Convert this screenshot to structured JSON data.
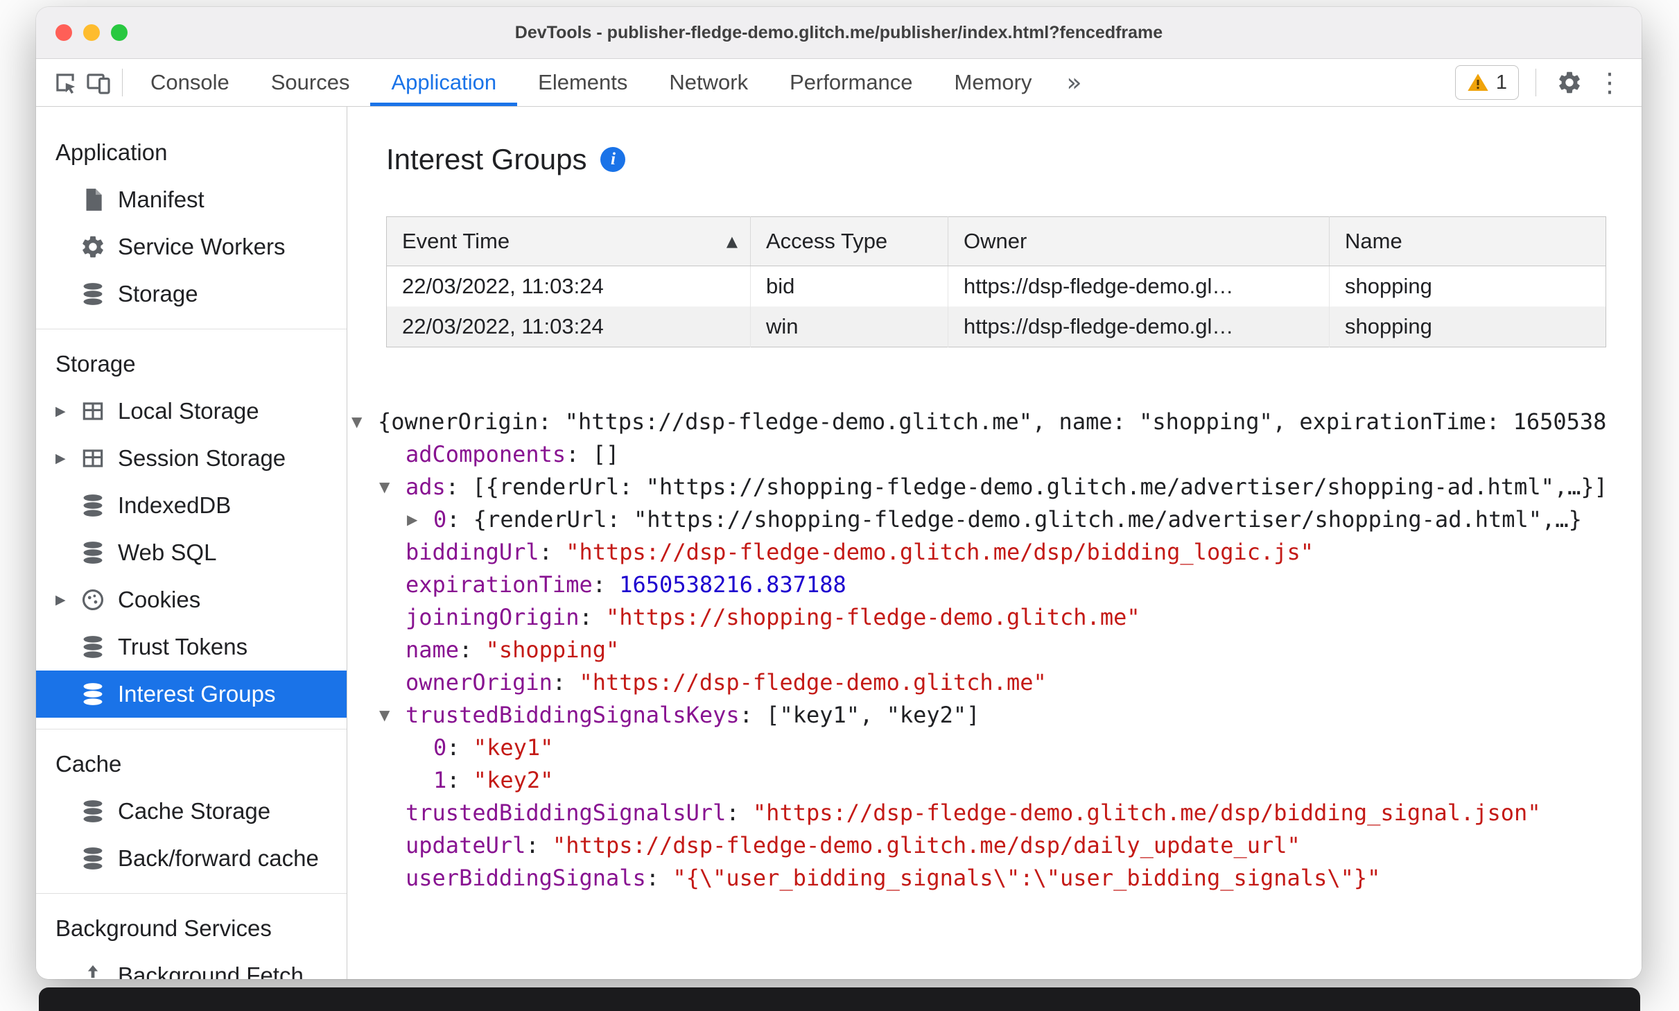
{
  "window": {
    "title": "DevTools - publisher-fledge-demo.glitch.me/publisher/index.html?fencedframe"
  },
  "toolbar": {
    "warning_count": "1",
    "tabs": [
      {
        "label": "Console",
        "active": false
      },
      {
        "label": "Sources",
        "active": false
      },
      {
        "label": "Application",
        "active": true
      },
      {
        "label": "Elements",
        "active": false
      },
      {
        "label": "Network",
        "active": false
      },
      {
        "label": "Performance",
        "active": false
      },
      {
        "label": "Memory",
        "active": false
      }
    ]
  },
  "icons": {
    "more_tabs": "»",
    "dots": "⋮",
    "info": "i",
    "sort_asc": "▲",
    "collapse": "▼",
    "expand": "▶",
    "twisty": "▶"
  },
  "sidebar": {
    "sections": [
      {
        "title": "Application",
        "items": [
          {
            "label": "Manifest",
            "icon": "document-icon",
            "expandable": false,
            "selected": false
          },
          {
            "label": "Service Workers",
            "icon": "gear-icon",
            "expandable": false,
            "selected": false
          },
          {
            "label": "Storage",
            "icon": "database-icon",
            "expandable": false,
            "selected": false
          }
        ]
      },
      {
        "title": "Storage",
        "items": [
          {
            "label": "Local Storage",
            "icon": "table-icon",
            "expandable": true,
            "selected": false
          },
          {
            "label": "Session Storage",
            "icon": "table-icon",
            "expandable": true,
            "selected": false
          },
          {
            "label": "IndexedDB",
            "icon": "database-icon",
            "expandable": false,
            "selected": false
          },
          {
            "label": "Web SQL",
            "icon": "database-icon",
            "expandable": false,
            "selected": false
          },
          {
            "label": "Cookies",
            "icon": "cookie-icon",
            "expandable": true,
            "selected": false
          },
          {
            "label": "Trust Tokens",
            "icon": "database-icon",
            "expandable": false,
            "selected": false
          },
          {
            "label": "Interest Groups",
            "icon": "database-icon",
            "expandable": false,
            "selected": true
          }
        ]
      },
      {
        "title": "Cache",
        "items": [
          {
            "label": "Cache Storage",
            "icon": "database-icon",
            "expandable": false,
            "selected": false
          },
          {
            "label": "Back/forward cache",
            "icon": "database-icon",
            "expandable": false,
            "selected": false
          }
        ]
      },
      {
        "title": "Background Services",
        "items": [
          {
            "label": "Background Fetch",
            "icon": "fetch-icon",
            "expandable": false,
            "selected": false
          }
        ]
      }
    ]
  },
  "main": {
    "title": "Interest Groups",
    "table": {
      "columns": [
        "Event Time",
        "Access Type",
        "Owner",
        "Name"
      ],
      "sort_column": "Event Time",
      "rows": [
        [
          "22/03/2022, 11:03:24",
          "bid",
          "https://dsp-fledge-demo.gl…",
          "shopping"
        ],
        [
          "22/03/2022, 11:03:24",
          "win",
          "https://dsp-fledge-demo.gl…",
          "shopping"
        ]
      ]
    },
    "tree": [
      {
        "level": 0,
        "arrow": "down",
        "segments": [
          {
            "c": "plain",
            "t": "{ownerOrigin: \"https://dsp-fledge-demo.glitch.me\", name: \"shopping\", expirationTime: 1650538"
          }
        ]
      },
      {
        "level": 1,
        "arrow": "",
        "segments": [
          {
            "c": "key",
            "t": "adComponents"
          },
          {
            "c": "plain",
            "t": ": []"
          }
        ]
      },
      {
        "level": 1,
        "arrow": "down",
        "segments": [
          {
            "c": "key",
            "t": "ads"
          },
          {
            "c": "plain",
            "t": ": [{renderUrl: \"https://shopping-fledge-demo.glitch.me/advertiser/shopping-ad.html\",…}]"
          }
        ]
      },
      {
        "level": 2,
        "arrow": "right",
        "segments": [
          {
            "c": "key",
            "t": "0"
          },
          {
            "c": "plain",
            "t": ": {renderUrl: \"https://shopping-fledge-demo.glitch.me/advertiser/shopping-ad.html\",…}"
          }
        ]
      },
      {
        "level": 1,
        "arrow": "",
        "segments": [
          {
            "c": "key",
            "t": "biddingUrl"
          },
          {
            "c": "plain",
            "t": ": "
          },
          {
            "c": "string",
            "t": "\"https://dsp-fledge-demo.glitch.me/dsp/bidding_logic.js\""
          }
        ]
      },
      {
        "level": 1,
        "arrow": "",
        "segments": [
          {
            "c": "key",
            "t": "expirationTime"
          },
          {
            "c": "plain",
            "t": ": "
          },
          {
            "c": "number",
            "t": "1650538216.837188"
          }
        ]
      },
      {
        "level": 1,
        "arrow": "",
        "segments": [
          {
            "c": "key",
            "t": "joiningOrigin"
          },
          {
            "c": "plain",
            "t": ": "
          },
          {
            "c": "string",
            "t": "\"https://shopping-fledge-demo.glitch.me\""
          }
        ]
      },
      {
        "level": 1,
        "arrow": "",
        "segments": [
          {
            "c": "key",
            "t": "name"
          },
          {
            "c": "plain",
            "t": ": "
          },
          {
            "c": "string",
            "t": "\"shopping\""
          }
        ]
      },
      {
        "level": 1,
        "arrow": "",
        "segments": [
          {
            "c": "key",
            "t": "ownerOrigin"
          },
          {
            "c": "plain",
            "t": ": "
          },
          {
            "c": "string",
            "t": "\"https://dsp-fledge-demo.glitch.me\""
          }
        ]
      },
      {
        "level": 1,
        "arrow": "down",
        "segments": [
          {
            "c": "key",
            "t": "trustedBiddingSignalsKeys"
          },
          {
            "c": "plain",
            "t": ": [\"key1\", \"key2\"]"
          }
        ]
      },
      {
        "level": 2,
        "arrow": "",
        "segments": [
          {
            "c": "key",
            "t": "0"
          },
          {
            "c": "plain",
            "t": ": "
          },
          {
            "c": "string",
            "t": "\"key1\""
          }
        ]
      },
      {
        "level": 2,
        "arrow": "",
        "segments": [
          {
            "c": "key",
            "t": "1"
          },
          {
            "c": "plain",
            "t": ": "
          },
          {
            "c": "string",
            "t": "\"key2\""
          }
        ]
      },
      {
        "level": 1,
        "arrow": "",
        "segments": [
          {
            "c": "key",
            "t": "trustedBiddingSignalsUrl"
          },
          {
            "c": "plain",
            "t": ": "
          },
          {
            "c": "string",
            "t": "\"https://dsp-fledge-demo.glitch.me/dsp/bidding_signal.json\""
          }
        ]
      },
      {
        "level": 1,
        "arrow": "",
        "segments": [
          {
            "c": "key",
            "t": "updateUrl"
          },
          {
            "c": "plain",
            "t": ": "
          },
          {
            "c": "string",
            "t": "\"https://dsp-fledge-demo.glitch.me/dsp/daily_update_url\""
          }
        ]
      },
      {
        "level": 1,
        "arrow": "",
        "segments": [
          {
            "c": "key",
            "t": "userBiddingSignals"
          },
          {
            "c": "plain",
            "t": ": "
          },
          {
            "c": "string",
            "t": "\"{\\\"user_bidding_signals\\\":\\\"user_bidding_signals\\\"}\""
          }
        ]
      }
    ]
  },
  "colors": {
    "accent_blue": "#1a73e8",
    "key_purple": "#881391",
    "string_red": "#c41a16",
    "number_blue": "#1c00cf",
    "warning_yellow": "#f0a30a"
  }
}
